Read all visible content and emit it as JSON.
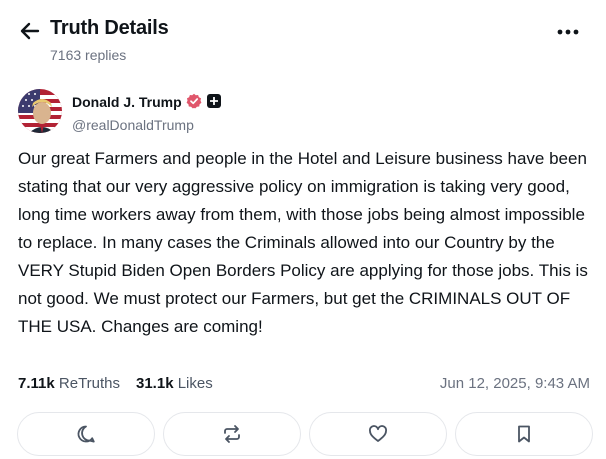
{
  "header": {
    "title": "Truth Details",
    "subtitle": "7163 replies",
    "back_icon": "arrow-left-icon",
    "more_icon": "more-horizontal-icon"
  },
  "author": {
    "name": "Donald J. Trump",
    "handle": "@realDonaldTrump",
    "verified_color": "#e0566b"
  },
  "post": {
    "text": "Our great Farmers and people in the Hotel and Leisure business have been stating that our very aggressive policy on immigration is taking very good, long time workers away from them, with those jobs being almost impossible to replace. In many cases the Criminals allowed into our Country by the VERY Stupid Biden Open Borders Policy are applying for those jobs. This is not good. We must protect our Farmers, but get the CRIMINALS OUT OF THE USA. Changes are coming!"
  },
  "stats": {
    "retruths_count": "7.11k",
    "retruths_label": "ReTruths",
    "likes_count": "31.1k",
    "likes_label": "Likes",
    "timestamp": "Jun 12, 2025, 9:43 AM"
  },
  "actions": {
    "reply_icon": "reply-icon",
    "retruth_icon": "retruth-icon",
    "like_icon": "heart-icon",
    "bookmark_icon": "bookmark-icon"
  }
}
